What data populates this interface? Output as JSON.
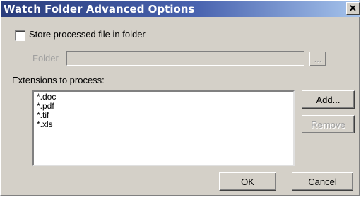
{
  "window": {
    "title": "Watch Folder Advanced Options",
    "close_glyph": "✕"
  },
  "store_option": {
    "label": "Store processed file in folder",
    "checked": false
  },
  "folder": {
    "label": "Folder",
    "value": "",
    "browse_label": "..."
  },
  "extensions": {
    "label": "Extensions to process:",
    "items": [
      "*.doc",
      "*.pdf",
      "*.tif",
      "*.xls"
    ],
    "add_label": "Add...",
    "remove_label": "Remove"
  },
  "footer": {
    "ok_label": "OK",
    "cancel_label": "Cancel"
  }
}
